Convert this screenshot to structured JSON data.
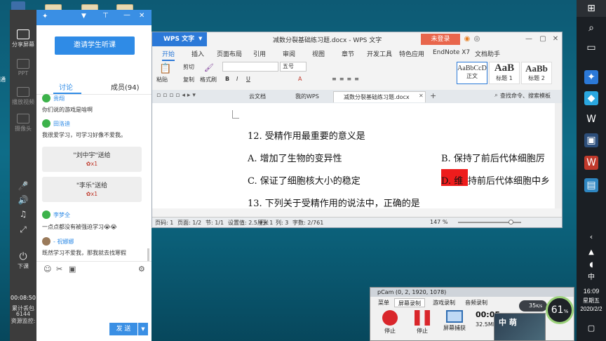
{
  "desktop": {
    "left_edge_labels": [
      "通",
      "PPT",
      "课"
    ],
    "icons": [
      "folder",
      "folder",
      "folder",
      "folder"
    ]
  },
  "taskbar": {
    "time": "16:09",
    "weekday": "星期五",
    "date": "2020/2/2",
    "icons": [
      "windows-icon",
      "search-icon",
      "task-view-icon",
      "chat-app-icon",
      "wps-icon",
      "folder-icon",
      "bandicam-icon",
      "browser-icon",
      "word-icon",
      "tray-chevron-icon",
      "network-icon",
      "volume-icon",
      "ime-icon",
      "notification-icon"
    ]
  },
  "chat_strip": {
    "items": [
      {
        "label": "分享屏幕",
        "icon": "share-screen-icon"
      },
      {
        "label": "PPT",
        "icon": "ppt-icon"
      },
      {
        "label": "播放视频",
        "icon": "video-icon"
      },
      {
        "label": "摄像头",
        "icon": "camera-icon"
      },
      {
        "label": "下课",
        "icon": "power-icon"
      }
    ],
    "timer": "00:08:50",
    "stats_line1": "累计丢包",
    "stats_line2": "6144",
    "stats_line3": "资源监控:",
    "left_cut_labels": [
      "分",
      "题"
    ]
  },
  "chat": {
    "invite_label": "邀请学生听课",
    "tab_discuss": "讨论",
    "tab_members": "成员(94)",
    "messages": [
      {
        "name": "贵翔",
        "text": "你们说的游戏是啥啊"
      },
      {
        "name": "田洛迪",
        "text": "我很爱学习，可学习好像不爱我。"
      },
      {
        "name": "李梦全",
        "text": "一点点都没有被强迫学习😭😭"
      },
      {
        "name": "- 祝娜娜",
        "text": "既然学习不爱我，那我就去找寒假"
      }
    ],
    "gifts": [
      {
        "text": "\"刘中宇\"送给",
        "item": "x1"
      },
      {
        "text": "\"李乐\"送给",
        "item": "x1"
      }
    ],
    "send_label": "发 送"
  },
  "wps": {
    "app_name": "WPS 文字",
    "doc_title": "减数分裂基础练习题.docx - WPS 文字",
    "login_label": "未登录",
    "menu_tabs": [
      "开始",
      "插入",
      "页面布局",
      "引用",
      "审阅",
      "视图",
      "章节",
      "开发工具",
      "特色应用",
      "EndNote X7",
      "文档助手"
    ],
    "active_menu": "开始",
    "ribbon": {
      "paste": "粘贴",
      "cut": "剪切",
      "copy": "复制",
      "format_painter": "格式刷",
      "font_size": "五号",
      "styles": [
        {
          "preview": "AaBbCcD",
          "label": "正文"
        },
        {
          "preview": "AaB",
          "label": "标题 1"
        },
        {
          "preview": "AaBb",
          "label": "标题 2"
        }
      ]
    },
    "doc_tabs": [
      "云文档",
      "我的WPS",
      "减数分裂基础练习题.docx"
    ],
    "search_placeholder": "查找命令、搜索模板",
    "content": {
      "q12": "12.  受精作用最重要的意义是",
      "a": "A.  增加了生物的变异性",
      "b": "B.  保持了前后代体细胞厉",
      "c": "C.  保证了细胞核大小的稳定",
      "d_letter": "D.  维",
      "d_rest": "持前后代体细胞中乡",
      "q13": "13.  下列关于受精作用的说法中，正确的是"
    },
    "status": {
      "page": "页码: 1",
      "pages": "页面: 1/2",
      "section": "节: 1/1",
      "setting": "设置值: 2.5厘米",
      "row": "行: 1",
      "col": "列: 3",
      "words": "字数: 2/761",
      "zoom": "147 %"
    }
  },
  "bandicam": {
    "title": "pCam (0, 2, 1920, 1078)",
    "tabs": [
      "菜单",
      "屏幕录制",
      "游戏录制",
      "音频录制"
    ],
    "active_tab": "屏幕录制",
    "buttons": [
      "停止",
      "停止",
      "屏幕捕获"
    ],
    "time": "00:05",
    "size": "32.5MB",
    "speed": "35",
    "speed_unit": "K/s",
    "percent": "61",
    "percent_unit": "%",
    "overlay_text": "中 萌"
  }
}
